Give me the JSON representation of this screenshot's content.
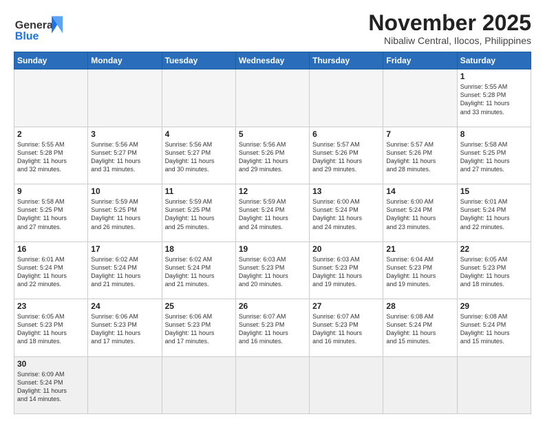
{
  "header": {
    "logo_general": "General",
    "logo_blue": "Blue",
    "month_title": "November 2025",
    "subtitle": "Nibaliw Central, Ilocos, Philippines"
  },
  "days_of_week": [
    "Sunday",
    "Monday",
    "Tuesday",
    "Wednesday",
    "Thursday",
    "Friday",
    "Saturday"
  ],
  "weeks": [
    [
      {
        "day": "",
        "info": ""
      },
      {
        "day": "",
        "info": ""
      },
      {
        "day": "",
        "info": ""
      },
      {
        "day": "",
        "info": ""
      },
      {
        "day": "",
        "info": ""
      },
      {
        "day": "",
        "info": ""
      },
      {
        "day": "1",
        "info": "Sunrise: 5:55 AM\nSunset: 5:28 PM\nDaylight: 11 hours\nand 33 minutes."
      }
    ],
    [
      {
        "day": "2",
        "info": "Sunrise: 5:55 AM\nSunset: 5:28 PM\nDaylight: 11 hours\nand 32 minutes."
      },
      {
        "day": "3",
        "info": "Sunrise: 5:56 AM\nSunset: 5:27 PM\nDaylight: 11 hours\nand 31 minutes."
      },
      {
        "day": "4",
        "info": "Sunrise: 5:56 AM\nSunset: 5:27 PM\nDaylight: 11 hours\nand 30 minutes."
      },
      {
        "day": "5",
        "info": "Sunrise: 5:56 AM\nSunset: 5:26 PM\nDaylight: 11 hours\nand 29 minutes."
      },
      {
        "day": "6",
        "info": "Sunrise: 5:57 AM\nSunset: 5:26 PM\nDaylight: 11 hours\nand 29 minutes."
      },
      {
        "day": "7",
        "info": "Sunrise: 5:57 AM\nSunset: 5:26 PM\nDaylight: 11 hours\nand 28 minutes."
      },
      {
        "day": "8",
        "info": "Sunrise: 5:58 AM\nSunset: 5:25 PM\nDaylight: 11 hours\nand 27 minutes."
      }
    ],
    [
      {
        "day": "9",
        "info": "Sunrise: 5:58 AM\nSunset: 5:25 PM\nDaylight: 11 hours\nand 27 minutes."
      },
      {
        "day": "10",
        "info": "Sunrise: 5:59 AM\nSunset: 5:25 PM\nDaylight: 11 hours\nand 26 minutes."
      },
      {
        "day": "11",
        "info": "Sunrise: 5:59 AM\nSunset: 5:25 PM\nDaylight: 11 hours\nand 25 minutes."
      },
      {
        "day": "12",
        "info": "Sunrise: 5:59 AM\nSunset: 5:24 PM\nDaylight: 11 hours\nand 24 minutes."
      },
      {
        "day": "13",
        "info": "Sunrise: 6:00 AM\nSunset: 5:24 PM\nDaylight: 11 hours\nand 24 minutes."
      },
      {
        "day": "14",
        "info": "Sunrise: 6:00 AM\nSunset: 5:24 PM\nDaylight: 11 hours\nand 23 minutes."
      },
      {
        "day": "15",
        "info": "Sunrise: 6:01 AM\nSunset: 5:24 PM\nDaylight: 11 hours\nand 22 minutes."
      }
    ],
    [
      {
        "day": "16",
        "info": "Sunrise: 6:01 AM\nSunset: 5:24 PM\nDaylight: 11 hours\nand 22 minutes."
      },
      {
        "day": "17",
        "info": "Sunrise: 6:02 AM\nSunset: 5:24 PM\nDaylight: 11 hours\nand 21 minutes."
      },
      {
        "day": "18",
        "info": "Sunrise: 6:02 AM\nSunset: 5:24 PM\nDaylight: 11 hours\nand 21 minutes."
      },
      {
        "day": "19",
        "info": "Sunrise: 6:03 AM\nSunset: 5:23 PM\nDaylight: 11 hours\nand 20 minutes."
      },
      {
        "day": "20",
        "info": "Sunrise: 6:03 AM\nSunset: 5:23 PM\nDaylight: 11 hours\nand 19 minutes."
      },
      {
        "day": "21",
        "info": "Sunrise: 6:04 AM\nSunset: 5:23 PM\nDaylight: 11 hours\nand 19 minutes."
      },
      {
        "day": "22",
        "info": "Sunrise: 6:05 AM\nSunset: 5:23 PM\nDaylight: 11 hours\nand 18 minutes."
      }
    ],
    [
      {
        "day": "23",
        "info": "Sunrise: 6:05 AM\nSunset: 5:23 PM\nDaylight: 11 hours\nand 18 minutes."
      },
      {
        "day": "24",
        "info": "Sunrise: 6:06 AM\nSunset: 5:23 PM\nDaylight: 11 hours\nand 17 minutes."
      },
      {
        "day": "25",
        "info": "Sunrise: 6:06 AM\nSunset: 5:23 PM\nDaylight: 11 hours\nand 17 minutes."
      },
      {
        "day": "26",
        "info": "Sunrise: 6:07 AM\nSunset: 5:23 PM\nDaylight: 11 hours\nand 16 minutes."
      },
      {
        "day": "27",
        "info": "Sunrise: 6:07 AM\nSunset: 5:23 PM\nDaylight: 11 hours\nand 16 minutes."
      },
      {
        "day": "28",
        "info": "Sunrise: 6:08 AM\nSunset: 5:24 PM\nDaylight: 11 hours\nand 15 minutes."
      },
      {
        "day": "29",
        "info": "Sunrise: 6:08 AM\nSunset: 5:24 PM\nDaylight: 11 hours\nand 15 minutes."
      }
    ],
    [
      {
        "day": "30",
        "info": "Sunrise: 6:09 AM\nSunset: 5:24 PM\nDaylight: 11 hours\nand 14 minutes."
      },
      {
        "day": "",
        "info": ""
      },
      {
        "day": "",
        "info": ""
      },
      {
        "day": "",
        "info": ""
      },
      {
        "day": "",
        "info": ""
      },
      {
        "day": "",
        "info": ""
      },
      {
        "day": "",
        "info": ""
      }
    ]
  ]
}
